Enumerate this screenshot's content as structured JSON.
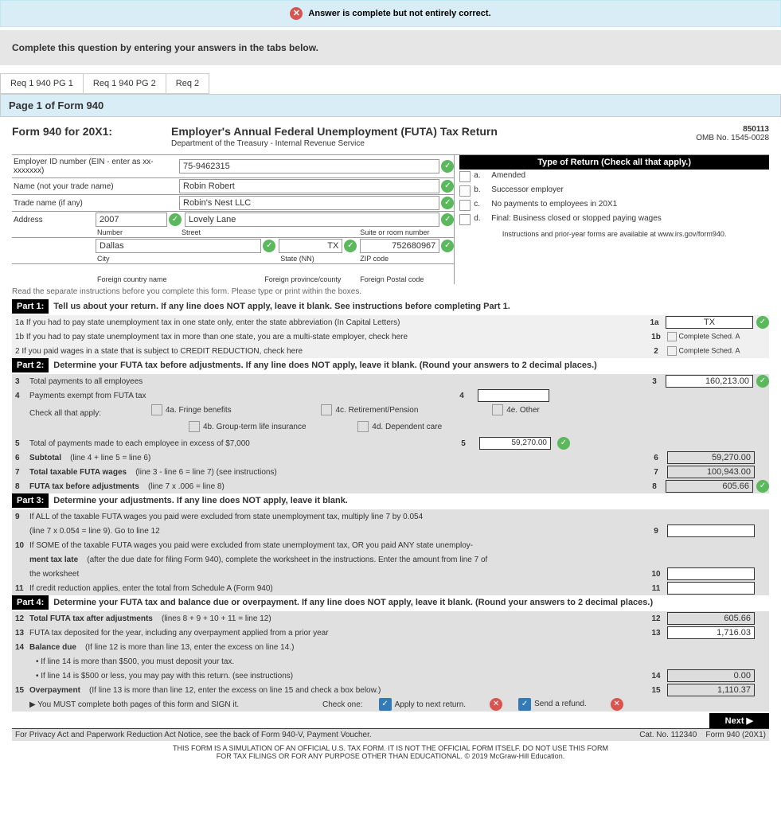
{
  "alert": {
    "text": "Answer is complete but not entirely correct."
  },
  "instruction": "Complete this question by entering your answers in the tabs below.",
  "tabs": [
    {
      "label": "Req 1 940 PG 1"
    },
    {
      "label": "Req 1 940 PG 2"
    },
    {
      "label": "Req 2"
    }
  ],
  "page_title": "Page 1 of Form 940",
  "form": {
    "title_prefix": "Form 940 for 20X1:",
    "title_main": "Employer's Annual Federal Unemployment (FUTA) Tax Return",
    "dept": "Department of the Treasury - Internal Revenue Service",
    "number": "850113",
    "omb": "OMB No. 1545-0028"
  },
  "employer": {
    "ein_label": "Employer ID number (EIN - enter as xx-xxxxxxx)",
    "ein": "75-9462315",
    "name_label": "Name (not your trade name)",
    "name": "Robin Robert",
    "trade_label": "Trade name (if any)",
    "trade": "Robin's Nest LLC",
    "address_label": "Address",
    "number_label": "Number",
    "street_label": "Street",
    "suite_label": "Suite or room number",
    "city_label": "City",
    "state_label": "State (NN)",
    "zip_label": "ZIP code",
    "foreign_country_label": "Foreign country name",
    "foreign_prov_label": "Foreign province/county",
    "foreign_postal_label": "Foreign Postal code",
    "number": "2007",
    "street": "Lovely Lane",
    "city": "Dallas",
    "state": "TX",
    "zip": "752680967"
  },
  "type_return": {
    "header": "Type of Return (Check all that apply.)",
    "a": "a.",
    "a_text": "Amended",
    "b": "b.",
    "b_text": "Successor employer",
    "c": "c.",
    "c_text": "No payments to employees in 20X1",
    "d": "d.",
    "d_text": "Final:  Business closed or stopped paying wages",
    "avail": "Instructions and prior-year forms are available at www.irs.gov/form940."
  },
  "read_sep": "Read the separate instructions before you complete this form.  Please type or print within the boxes.",
  "part1": {
    "label": "Part 1:",
    "desc": "Tell us about your return.  If any line does NOT apply, leave it blank. See instructions before completing Part 1.",
    "l1a": "1a If you had to pay state unemployment tax in one state only, enter the state abbreviation (In Capital Letters)",
    "l1a_num": "1a",
    "l1a_val": "TX",
    "l1b": "1b If you had to pay state unemployment tax in more than one state, you are a multi-state employer, check here",
    "l1b_num": "1b",
    "l1b_val": "Complete Sched. A",
    "l2": "2   If you paid wages in a state that is subject to CREDIT REDUCTION, check here",
    "l2_num": "2",
    "l2_val": "Complete Sched. A"
  },
  "part2": {
    "label": "Part 2:",
    "desc": "Determine your FUTA tax before adjustments.  If any line does NOT apply, leave it blank. (Round your answers to 2 decimal places.)",
    "l3": "Total payments to all employees",
    "l3_num": "3",
    "l3_val": "160,213.00",
    "l4": "Payments exempt from FUTA tax",
    "l4_num": "4",
    "l4_check": "Check all that apply:",
    "l4a": "4a. Fringe benefits",
    "l4b": "4b. Group-term life insurance",
    "l4c": "4c. Retirement/Pension",
    "l4d": "4d. Dependent care",
    "l4e": "4e. Other",
    "l5": "Total of payments made to each employee in excess of $7,000",
    "l5_num": "5",
    "l5_val": "59,270.00",
    "l6": "Subtotal",
    "l6_note": "(line 4 + line 5 = line 6)",
    "l6_num": "6",
    "l6_val": "59,270.00",
    "l7": "Total taxable FUTA wages",
    "l7_note": "(line 3 - line 6 = line 7) (see instructions)",
    "l7_num": "7",
    "l7_val": "100,943.00",
    "l8": "FUTA tax before adjustments",
    "l8_note": "(line 7 x .006 = line 8)",
    "l8_num": "8",
    "l8_val": "605.66"
  },
  "part3": {
    "label": "Part 3:",
    "desc": "Determine your adjustments.  If any line does NOT apply, leave it blank.",
    "l9": "If ALL of the taxable FUTA wages you paid were excluded from state unemployment tax, multiply line 7 by 0.054",
    "l9_note": "(line 7 x 0.054 = line 9).  Go to line 12",
    "l9_num": "9",
    "l10": "If SOME of the taxable FUTA wages you paid were excluded from state unemployment tax, OR you paid ANY state unemploy-",
    "l10b": "ment tax late",
    "l10_note": "(after the due date for filing Form 940), complete the worksheet in the instructions.  Enter the amount from line 7 of",
    "l10c": "the worksheet",
    "l10_num": "10",
    "l11": "If credit reduction applies, enter the total from Schedule A (Form 940)",
    "l11_num": "11"
  },
  "part4": {
    "label": "Part 4:",
    "desc": "Determine your FUTA tax and balance due or overpayment.  If any line does NOT apply, leave it blank. (Round your answers to 2 decimal places.)",
    "l12": "Total FUTA tax after adjustments",
    "l12_note": "(lines 8 + 9 + 10 + 11 = line 12)",
    "l12_num": "12",
    "l12_val": "605.66",
    "l13": "FUTA tax deposited for the year, including any overpayment applied from a prior year",
    "l13_num": "13",
    "l13_val": "1,716.03",
    "l14": "Balance due",
    "l14_note": "(If line 12 is more than line 13, enter the excess on line 14.)",
    "l14a": "If line 14 is more than $500, you must deposit your tax.",
    "l14b": "If line 14 is $500 or less, you may pay with this return. (see instructions)",
    "l14_num": "14",
    "l14_val": "0.00",
    "l15": "Overpayment",
    "l15_note": "(If line 13 is more than line 12, enter the excess on line 15 and check a box below.)",
    "l15_num": "15",
    "l15_val": "1,110.37",
    "sign": "▶ You MUST complete both pages of this form and SIGN it.",
    "check_one": "Check one:",
    "apply": "Apply to next return.",
    "refund": "Send a refund."
  },
  "footer": {
    "next": "Next ▶",
    "privacy": "For Privacy Act and Paperwork Reduction Act Notice, see the back of Form 940-V, Payment Voucher.",
    "cat": "Cat. No. 112340",
    "formver": "Form 940  (20X1)",
    "disclaimer1": "THIS FORM IS A SIMULATION OF AN OFFICIAL U.S. TAX FORM. IT IS NOT THE OFFICIAL FORM ITSELF. DO NOT USE THIS FORM",
    "disclaimer2": "FOR TAX FILINGS OR FOR ANY PURPOSE OTHER THAN EDUCATIONAL. © 2019 McGraw-Hill Education."
  }
}
